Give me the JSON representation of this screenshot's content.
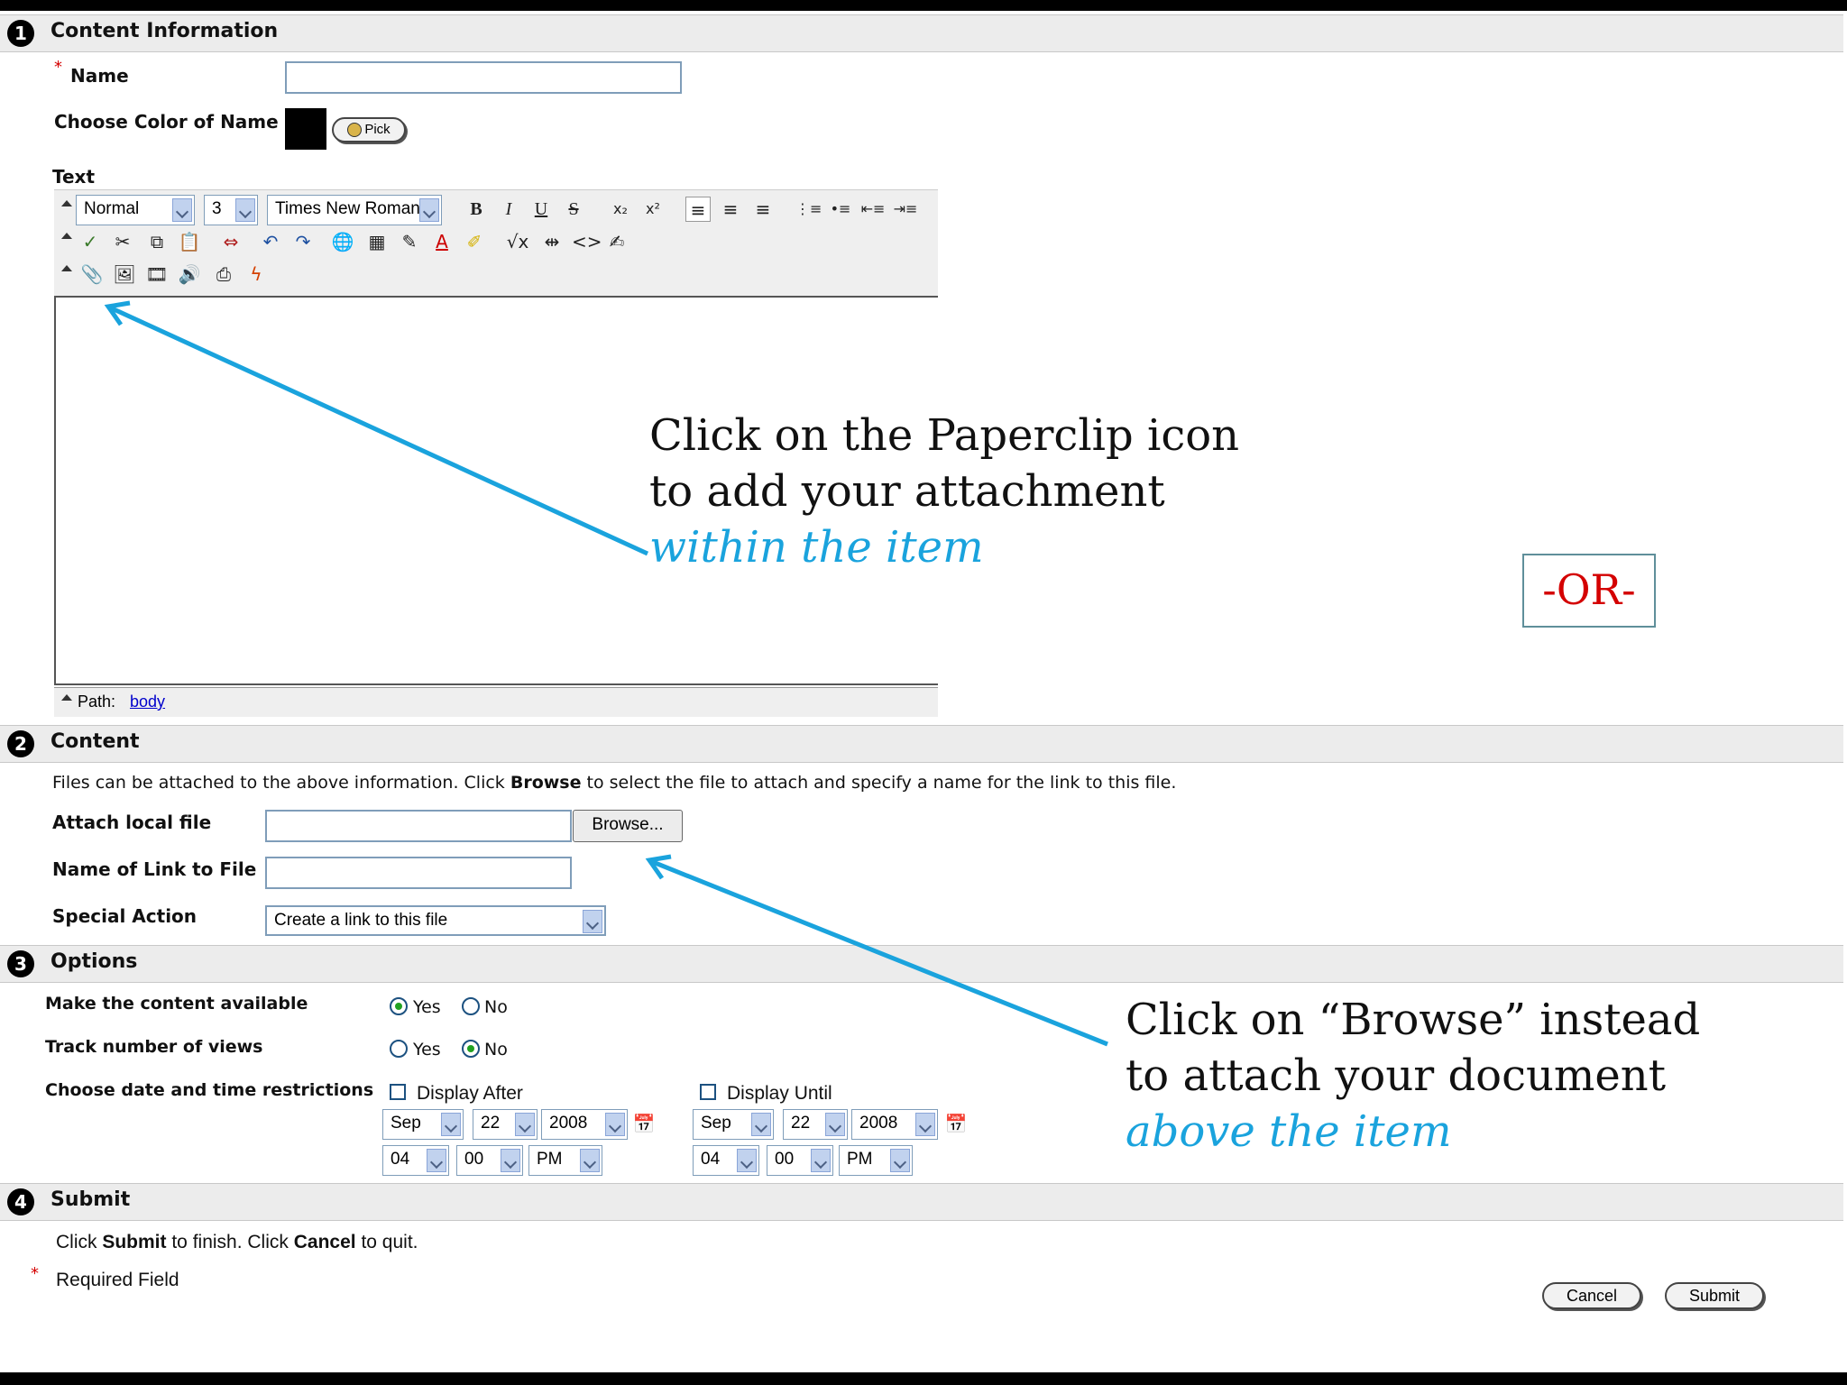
{
  "sections": [
    {
      "num": "1",
      "title": "Content Information"
    },
    {
      "num": "2",
      "title": "Content"
    },
    {
      "num": "3",
      "title": "Options"
    },
    {
      "num": "4",
      "title": "Submit"
    }
  ],
  "content_info": {
    "required_mark": "*",
    "name_label": "Name",
    "name_value": "",
    "color_label": "Choose Color of Name",
    "color_value": "#000000",
    "pick_label": "Pick",
    "text_label": "Text"
  },
  "editor": {
    "style_select": "Normal",
    "size_select": "3",
    "font_select": "Times New Roman",
    "path_label": "Path:",
    "path_link": "body"
  },
  "content": {
    "description_pre": "Files can be attached to the above information. Click ",
    "description_bold": "Browse",
    "description_post": " to select the file to attach and specify a name for the link to this file.",
    "attach_label": "Attach local file",
    "attach_value": "",
    "browse_label": "Browse...",
    "link_name_label": "Name of Link to File",
    "link_name_value": "",
    "special_action_label": "Special Action",
    "special_action_value": "Create a link to this file"
  },
  "options": {
    "available_label": "Make the content available",
    "track_label": "Track number of views",
    "restrict_label": "Choose date and time restrictions",
    "yes_label": "Yes",
    "no_label": "No",
    "available_selected": "Yes",
    "track_selected": "No",
    "display_after_label": "Display After",
    "display_until_label": "Display Until",
    "after": {
      "month": "Sep",
      "day": "22",
      "year": "2008",
      "hour": "04",
      "minute": "00",
      "ampm": "PM"
    },
    "until": {
      "month": "Sep",
      "day": "22",
      "year": "2008",
      "hour": "04",
      "minute": "00",
      "ampm": "PM"
    }
  },
  "submit": {
    "instr_1": "Click ",
    "instr_submit": "Submit",
    "instr_2": " to finish. Click ",
    "instr_cancel": "Cancel",
    "instr_3": " to quit.",
    "required_note": "Required Field",
    "cancel_label": "Cancel",
    "submit_label": "Submit"
  },
  "callouts": {
    "paperclip_line1": "Click on the Paperclip icon",
    "paperclip_line2": "to add your attachment",
    "paperclip_line3": "within the item",
    "or_label": "-OR-",
    "browse_line1": "Click on “Browse” instead",
    "browse_line2": "to attach your document",
    "browse_line3": "above the item"
  },
  "colors": {
    "accent_arrow": "#1aa3dd",
    "or_text": "#d40000",
    "section_bg": "#ececec",
    "required": "#d40000",
    "link": "#0000cc"
  }
}
